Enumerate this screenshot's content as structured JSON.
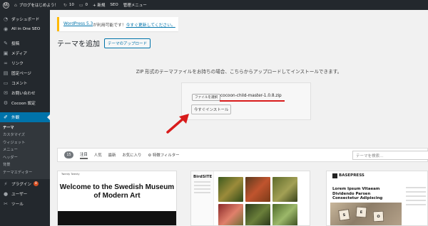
{
  "adminbar": {
    "site_name": "ブログをはじめよう！",
    "updates": "10",
    "comments": "0",
    "new_label": "+ 新規",
    "seo_label": "SEO",
    "admin_menu": "管理メニュー"
  },
  "sidebar": {
    "items": [
      {
        "label": "ダッシュボード",
        "icon": "dashboard-icon"
      },
      {
        "label": "All in One SEO",
        "icon": "seo-icon"
      },
      {
        "label": "投稿",
        "icon": "pin-icon"
      },
      {
        "label": "メディア",
        "icon": "media-icon"
      },
      {
        "label": "リンク",
        "icon": "link-icon"
      },
      {
        "label": "固定ページ",
        "icon": "page-icon"
      },
      {
        "label": "コメント",
        "icon": "comment-icon"
      },
      {
        "label": "お問い合わせ",
        "icon": "mail-icon"
      },
      {
        "label": "Cocoon 設定",
        "icon": "gear-icon"
      },
      {
        "label": "外観",
        "icon": "paint-brush-icon"
      }
    ],
    "submenu": [
      "テーマ",
      "カスタマイズ",
      "ウィジェット",
      "メニュー",
      "ヘッダー",
      "背景",
      "テーマエディター"
    ],
    "after": [
      {
        "label": "プラグイン",
        "badge": "8",
        "icon": "plugin-icon"
      },
      {
        "label": "ユーザー",
        "icon": "user-icon"
      },
      {
        "label": "ツール",
        "icon": "tool-icon"
      }
    ]
  },
  "notice": {
    "link": "WordPress 5.3",
    "text": " が利用可能です！",
    "link2": "今すぐ更新してください。"
  },
  "page": {
    "title": "テーマを追加",
    "upload_button": "テーマのアップロード",
    "description": "ZIP 形式のテーマファイルをお持ちの場合、こちらからアップロードしてインストールできます。",
    "file_button": "ファイルを選択",
    "file_name": "cocoon-child-master-1.0.8.zip",
    "install_button": "今すぐインストール"
  },
  "filter": {
    "count": "15",
    "tabs": [
      "注目",
      "人気",
      "最新",
      "お気に入り"
    ],
    "feature_filter": "特徴フィルター",
    "search_placeholder": "テーマを検索..."
  },
  "themes": {
    "twenty_twenty_header": "Twenty Twenty",
    "twenty_twenty_title": "Welcome to the Swedish Museum of Modern Art",
    "birdsite_logo": "BirdSITE",
    "basepress_logo": "BASEPRESS",
    "basepress_heading": "Lorem Ipsum Vitaeam Dividendo Parsen Consectetur Adipiscing",
    "seo_tiles": [
      "S",
      "E",
      "O"
    ]
  },
  "colors": {
    "adminbar": "#23282d",
    "active": "#0073aa",
    "notice_border": "#ffb900",
    "arrow": "#d81b1b"
  }
}
